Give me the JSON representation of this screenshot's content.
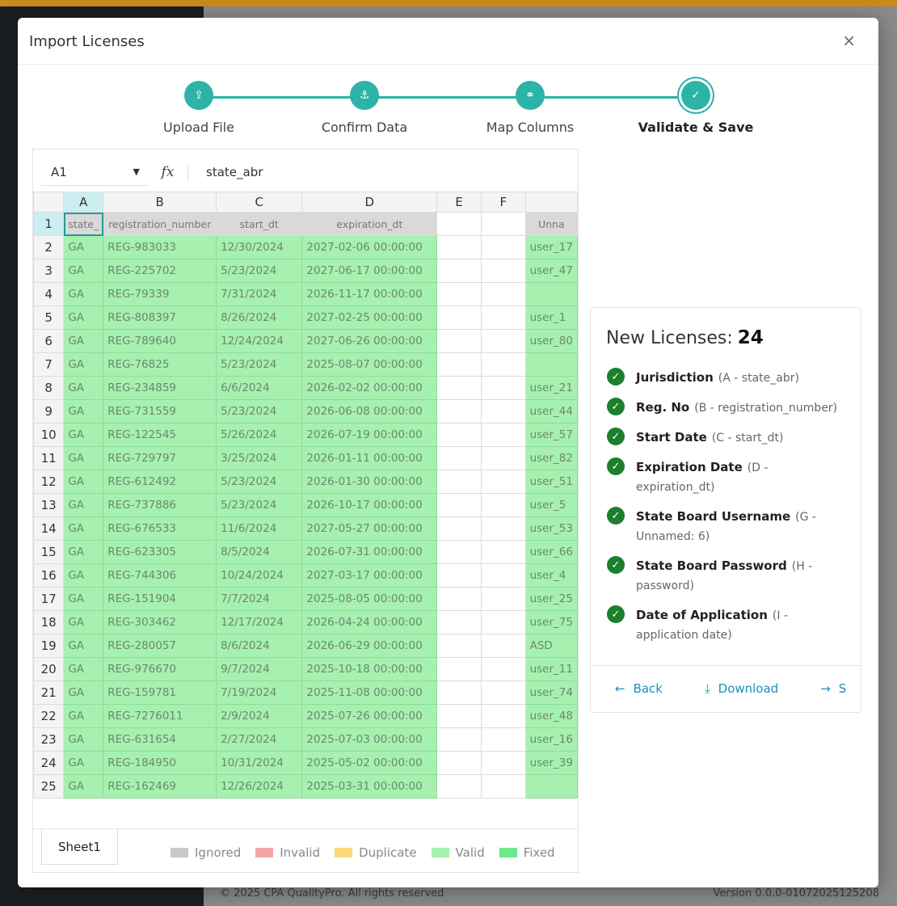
{
  "background": {
    "footer_left": "© 2025 CPA QualityPro. All rights reserved",
    "footer_right": "Version 0.0.0-01072025125208"
  },
  "modal": {
    "title": "Import Licenses",
    "close_icon": "×"
  },
  "stepper": {
    "steps": [
      {
        "label": "Upload File",
        "icon": "upload-icon",
        "glyph": "⇪"
      },
      {
        "label": "Confirm Data",
        "icon": "anchor-icon",
        "glyph": "⚓"
      },
      {
        "label": "Map Columns",
        "icon": "link-icon",
        "glyph": "⚭"
      },
      {
        "label": "Validate & Save",
        "icon": "save-icon",
        "glyph": "✓"
      }
    ],
    "active": 3,
    "color": "#2bb4a7"
  },
  "sheet": {
    "cell_ref": "A1",
    "fx_label": "fx",
    "formula_value": "state_abr",
    "columns": [
      "A",
      "B",
      "C",
      "D",
      "E",
      "F",
      ""
    ],
    "header_row": [
      "state_",
      "registration_number",
      "start_dt",
      "expiration_dt",
      "",
      "",
      "Unna"
    ],
    "rows": [
      [
        "GA",
        "REG-983033",
        "12/30/2024",
        "2027-02-06 00:00:00",
        "user_17"
      ],
      [
        "GA",
        "REG-225702",
        "5/23/2024",
        "2027-06-17 00:00:00",
        "user_47"
      ],
      [
        "GA",
        "REG-79339",
        "7/31/2024",
        "2026-11-17 00:00:00",
        ""
      ],
      [
        "GA",
        "REG-808397",
        "8/26/2024",
        "2027-02-25 00:00:00",
        "user_1"
      ],
      [
        "GA",
        "REG-789640",
        "12/24/2024",
        "2027-06-26 00:00:00",
        "user_80"
      ],
      [
        "GA",
        "REG-76825",
        "5/23/2024",
        "2025-08-07 00:00:00",
        ""
      ],
      [
        "GA",
        "REG-234859",
        "6/6/2024",
        "2026-02-02 00:00:00",
        "user_21"
      ],
      [
        "GA",
        "REG-731559",
        "5/23/2024",
        "2026-06-08 00:00:00",
        "user_44"
      ],
      [
        "GA",
        "REG-122545",
        "5/26/2024",
        "2026-07-19 00:00:00",
        "user_57"
      ],
      [
        "GA",
        "REG-729797",
        "3/25/2024",
        "2026-01-11 00:00:00",
        "user_82"
      ],
      [
        "GA",
        "REG-612492",
        "5/23/2024",
        "2026-01-30 00:00:00",
        "user_51"
      ],
      [
        "GA",
        "REG-737886",
        "5/23/2024",
        "2026-10-17 00:00:00",
        "user_5"
      ],
      [
        "GA",
        "REG-676533",
        "11/6/2024",
        "2027-05-27 00:00:00",
        "user_53"
      ],
      [
        "GA",
        "REG-623305",
        "8/5/2024",
        "2026-07-31 00:00:00",
        "user_66"
      ],
      [
        "GA",
        "REG-744306",
        "10/24/2024",
        "2027-03-17 00:00:00",
        "user_4"
      ],
      [
        "GA",
        "REG-151904",
        "7/7/2024",
        "2025-08-05 00:00:00",
        "user_25"
      ],
      [
        "GA",
        "REG-303462",
        "12/17/2024",
        "2026-04-24 00:00:00",
        "user_75"
      ],
      [
        "GA",
        "REG-280057",
        "8/6/2024",
        "2026-06-29 00:00:00",
        "ASD"
      ],
      [
        "GA",
        "REG-976670",
        "9/7/2024",
        "2025-10-18 00:00:00",
        "user_11"
      ],
      [
        "GA",
        "REG-159781",
        "7/19/2024",
        "2025-11-08 00:00:00",
        "user_74"
      ],
      [
        "GA",
        "REG-7276011",
        "2/9/2024",
        "2025-07-26 00:00:00",
        "user_48"
      ],
      [
        "GA",
        "REG-631654",
        "2/27/2024",
        "2025-07-03 00:00:00",
        "user_16"
      ],
      [
        "GA",
        "REG-184950",
        "10/31/2024",
        "2025-05-02 00:00:00",
        "user_39"
      ],
      [
        "GA",
        "REG-162469",
        "12/26/2024",
        "2025-03-31 00:00:00",
        ""
      ]
    ],
    "tab_name": "Sheet1",
    "legend": [
      {
        "label": "Ignored",
        "color": "#c8c8c8"
      },
      {
        "label": "Invalid",
        "color": "#f4a6a6"
      },
      {
        "label": "Duplicate",
        "color": "#fcd77a"
      },
      {
        "label": "Valid",
        "color": "#a6f0b0"
      },
      {
        "label": "Fixed",
        "color": "#6ee88a"
      }
    ]
  },
  "summary": {
    "title": "New Licenses:",
    "count": "24",
    "fields": [
      {
        "name": "Jurisdiction",
        "detail": "(A - state_abr)"
      },
      {
        "name": "Reg. No",
        "detail": "(B - registration_number)"
      },
      {
        "name": "Start Date",
        "detail": "(C - start_dt)"
      },
      {
        "name": "Expiration Date",
        "detail": "(D - expiration_dt)"
      },
      {
        "name": "State Board Username",
        "detail": "(G - Unnamed: 6)"
      },
      {
        "name": "State Board Password",
        "detail": "(H - password)"
      },
      {
        "name": "Date of Application",
        "detail": "(I - application date)"
      }
    ],
    "actions": {
      "back": "Back",
      "download": "Download",
      "save": "S"
    }
  }
}
